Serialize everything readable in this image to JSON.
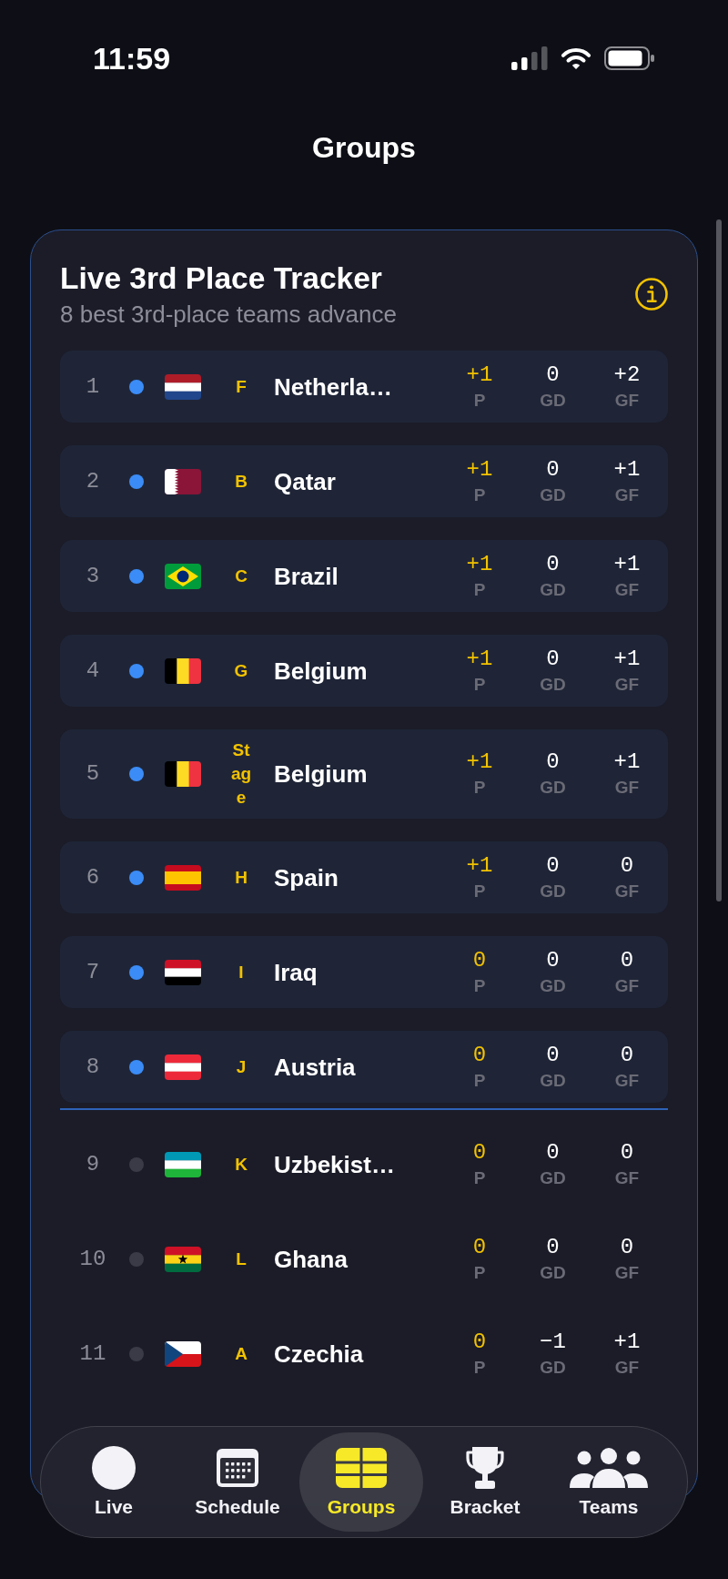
{
  "status_bar": {
    "time": "11:59"
  },
  "header": {
    "title": "Groups"
  },
  "tracker": {
    "title": "Live 3rd Place Tracker",
    "subtitle": "8 best 3rd-place teams advance",
    "rows": [
      {
        "rank": "1",
        "qualified": true,
        "group": "F",
        "team": "Netherla…",
        "stats": [
          {
            "value": "+1",
            "label": "P"
          },
          {
            "value": "0",
            "label": "GD"
          },
          {
            "value": "+2",
            "label": "GF"
          }
        ]
      },
      {
        "rank": "2",
        "qualified": true,
        "group": "B",
        "team": "Qatar",
        "stats": [
          {
            "value": "+1",
            "label": "P"
          },
          {
            "value": "0",
            "label": "GD"
          },
          {
            "value": "+1",
            "label": "GF"
          }
        ]
      },
      {
        "rank": "3",
        "qualified": true,
        "group": "C",
        "team": "Brazil",
        "stats": [
          {
            "value": "+1",
            "label": "P"
          },
          {
            "value": "0",
            "label": "GD"
          },
          {
            "value": "+1",
            "label": "GF"
          }
        ]
      },
      {
        "rank": "4",
        "qualified": true,
        "group": "G",
        "team": "Belgium",
        "stats": [
          {
            "value": "+1",
            "label": "P"
          },
          {
            "value": "0",
            "label": "GD"
          },
          {
            "value": "+1",
            "label": "GF"
          }
        ]
      },
      {
        "rank": "5",
        "qualified": true,
        "group": "Stage",
        "team": "Belgium",
        "stats": [
          {
            "value": "+1",
            "label": "P"
          },
          {
            "value": "0",
            "label": "GD"
          },
          {
            "value": "+1",
            "label": "GF"
          }
        ]
      },
      {
        "rank": "6",
        "qualified": true,
        "group": "H",
        "team": "Spain",
        "stats": [
          {
            "value": "+1",
            "label": "P"
          },
          {
            "value": "0",
            "label": "GD"
          },
          {
            "value": "0",
            "label": "GF"
          }
        ]
      },
      {
        "rank": "7",
        "qualified": true,
        "group": "I",
        "team": "Iraq",
        "stats": [
          {
            "value": "0",
            "label": "P"
          },
          {
            "value": "0",
            "label": "GD"
          },
          {
            "value": "0",
            "label": "GF"
          }
        ]
      },
      {
        "rank": "8",
        "qualified": true,
        "group": "J",
        "team": "Austria",
        "stats": [
          {
            "value": "0",
            "label": "P"
          },
          {
            "value": "0",
            "label": "GD"
          },
          {
            "value": "0",
            "label": "GF"
          }
        ]
      },
      {
        "rank": "9",
        "qualified": false,
        "group": "K",
        "team": "Uzbekist…",
        "stats": [
          {
            "value": "0",
            "label": "P"
          },
          {
            "value": "0",
            "label": "GD"
          },
          {
            "value": "0",
            "label": "GF"
          }
        ]
      },
      {
        "rank": "10",
        "qualified": false,
        "group": "L",
        "team": "Ghana",
        "stats": [
          {
            "value": "0",
            "label": "P"
          },
          {
            "value": "0",
            "label": "GD"
          },
          {
            "value": "0",
            "label": "GF"
          }
        ]
      },
      {
        "rank": "11",
        "qualified": false,
        "group": "A",
        "team": "Czechia",
        "stats": [
          {
            "value": "0",
            "label": "P"
          },
          {
            "value": "−1",
            "label": "GD"
          },
          {
            "value": "+1",
            "label": "GF"
          }
        ]
      }
    ]
  },
  "tab_bar": {
    "tabs": [
      {
        "label": "Live",
        "selected": false
      },
      {
        "label": "Schedule",
        "selected": false
      },
      {
        "label": "Groups",
        "selected": true
      },
      {
        "label": "Bracket",
        "selected": false
      },
      {
        "label": "Teams",
        "selected": false
      }
    ]
  }
}
